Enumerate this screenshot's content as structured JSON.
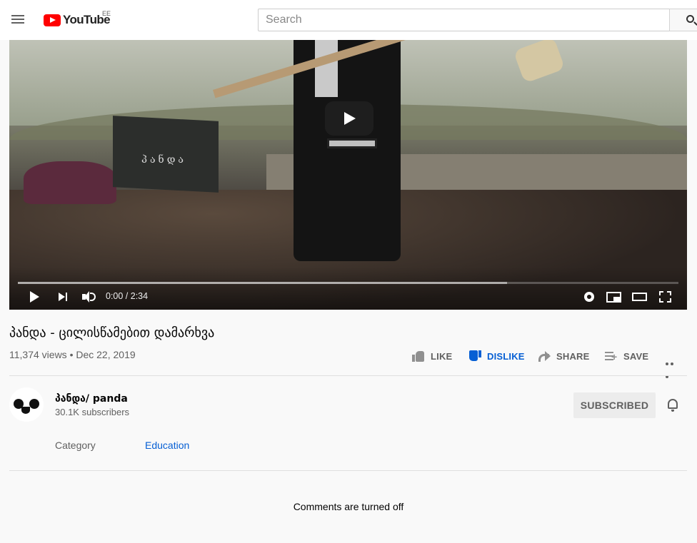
{
  "masthead": {
    "logo_text": "YouTube",
    "country_code": "EE",
    "search_placeholder": "Search"
  },
  "player": {
    "gravestone_text": "პანდა",
    "current_time": "0:00",
    "duration": "2:34",
    "time_display": "0:00 / 2:34",
    "buffered_fraction": 0.74,
    "icons": [
      "play-icon",
      "next-icon",
      "volume-icon",
      "settings-gear-icon",
      "miniplayer-icon",
      "theater-mode-icon",
      "fullscreen-icon"
    ]
  },
  "video": {
    "title": "პანდა - ცილისწამებით დამარხვა",
    "views": "11,374 views",
    "separator": "•",
    "date": "Dec 22, 2019",
    "meta": "11,374 views • Dec 22, 2019"
  },
  "actions": {
    "like": "LIKE",
    "dislike": "DISLIKE",
    "share": "SHARE",
    "save": "SAVE",
    "dislike_active_color": "#065fd4"
  },
  "channel": {
    "name": "პანდა/ panda",
    "subscribers": "30.1K subscribers",
    "subscribe_label": "SUBSCRIBED"
  },
  "details": {
    "category_label": "Category",
    "category_value": "Education"
  },
  "comments": {
    "status": "Comments are turned off"
  },
  "colors": {
    "brand_red": "#ff0000",
    "link_blue": "#065fd4",
    "background": "#f9f9f9"
  }
}
